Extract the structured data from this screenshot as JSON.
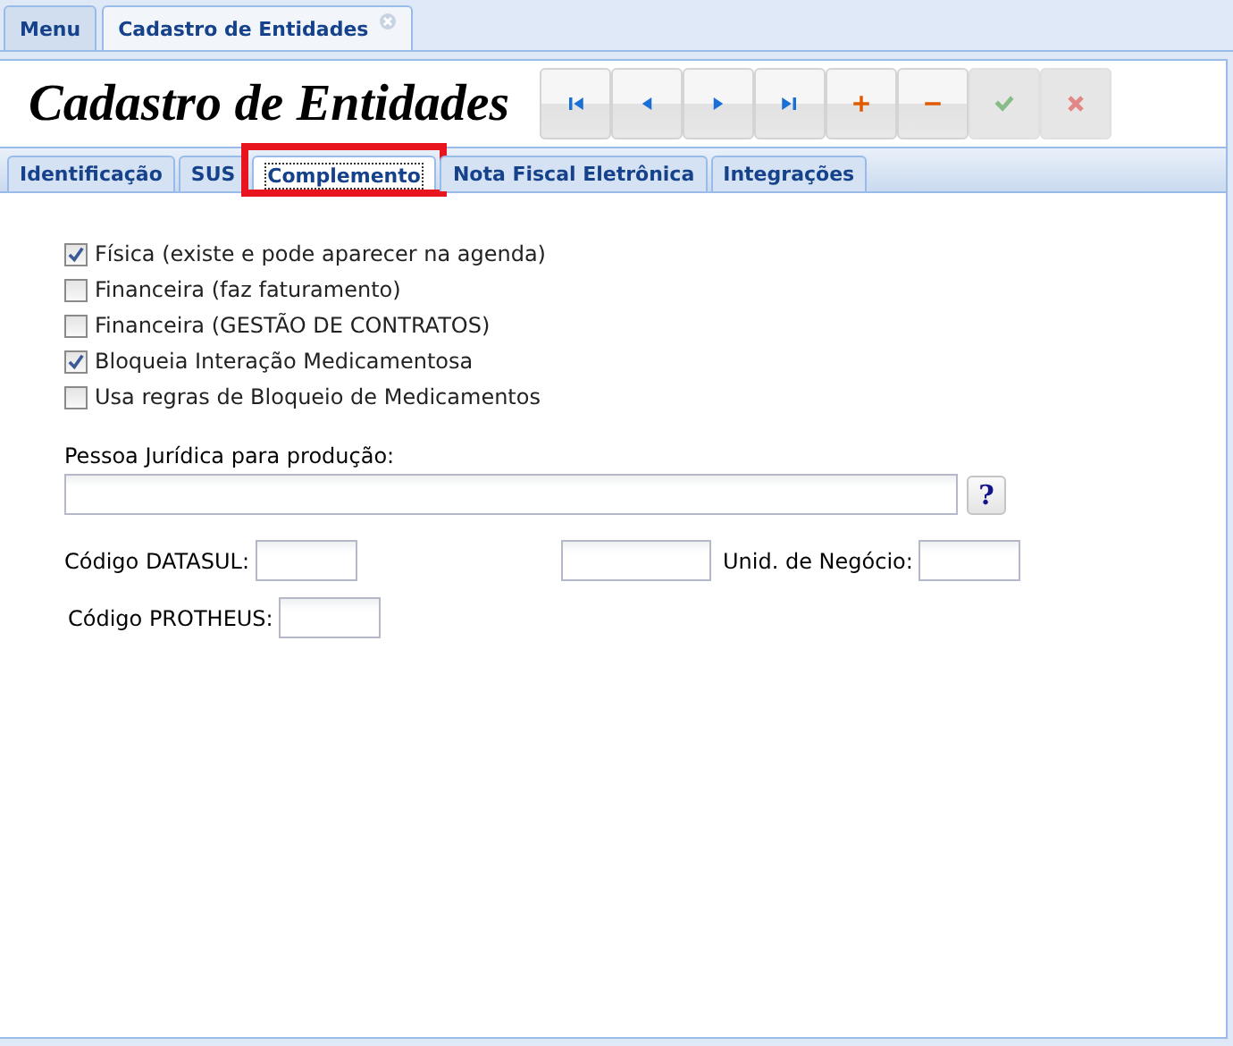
{
  "window_tabs": [
    {
      "label": "Menu",
      "selected": false,
      "closable": false
    },
    {
      "label": "Cadastro de Entidades",
      "selected": true,
      "closable": true
    }
  ],
  "page_title": "Cadastro de Entidades",
  "toolbar": [
    {
      "kind": "first",
      "disabled": false
    },
    {
      "kind": "prev",
      "disabled": false
    },
    {
      "kind": "next",
      "disabled": false
    },
    {
      "kind": "last",
      "disabled": false
    },
    {
      "kind": "add",
      "disabled": false
    },
    {
      "kind": "remove",
      "disabled": false
    },
    {
      "kind": "confirm",
      "disabled": true
    },
    {
      "kind": "cancel",
      "disabled": true
    }
  ],
  "tabs": [
    {
      "label": "Identificação",
      "selected": false,
      "highlighted": false
    },
    {
      "label": "SUS",
      "selected": false,
      "highlighted": false
    },
    {
      "label": "Complemento",
      "selected": true,
      "highlighted": true
    },
    {
      "label": "Nota Fiscal Eletrônica",
      "selected": false,
      "highlighted": false
    },
    {
      "label": "Integrações",
      "selected": false,
      "highlighted": false
    }
  ],
  "checkboxes": [
    {
      "label": "Física (existe e pode aparecer na agenda)",
      "checked": true
    },
    {
      "label": "Financeira (faz faturamento)",
      "checked": false
    },
    {
      "label": "Financeira (GESTÃO DE CONTRATOS)",
      "checked": false
    },
    {
      "label": "Bloqueia Interação Medicamentosa",
      "checked": true
    },
    {
      "label": "Usa regras de Bloqueio de Medicamentos",
      "checked": false
    }
  ],
  "pessoa_juridica": {
    "label": "Pessoa Jurídica para produção:",
    "help": "?"
  },
  "codigo_datasul": {
    "label": "Código DATASUL:"
  },
  "unid_negocio": {
    "label": "Unid. de Negócio:"
  },
  "codigo_protheus": {
    "label": "Código PROTHEUS:"
  }
}
